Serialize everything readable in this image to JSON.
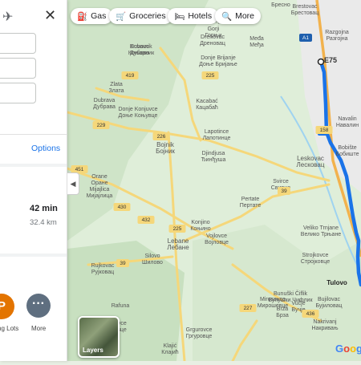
{
  "sidebar": {
    "options_label": "Options",
    "route": {
      "time": "42 min",
      "distance": "32.4 km"
    },
    "bottom_actions": [
      {
        "badge": "P",
        "label": "ng Lots"
      },
      {
        "badge": "···",
        "label": "More"
      }
    ]
  },
  "chips": [
    {
      "icon": "gas-station-icon",
      "label": "Gas"
    },
    {
      "icon": "cart-icon",
      "label": "Groceries"
    },
    {
      "icon": "bed-icon",
      "label": "Hotels"
    },
    {
      "icon": "search-icon",
      "label": "More"
    }
  ],
  "layers_label": "Layers",
  "google_logo": "Google",
  "route_color": "#1a73e8",
  "places": [
    {
      "name": "Бресно",
      "sub": ""
    },
    {
      "name": "Brestovac",
      "sub": "Брестовац"
    },
    {
      "name": "Gornji",
      "sub": ""
    },
    {
      "name": "Gorji",
      "sub": "Горњи"
    },
    {
      "name": "Drenovac",
      "sub": "Дреновац"
    },
    {
      "name": "Međa",
      "sub": "Међа"
    },
    {
      "name": "Razgojna",
      "sub": "Разгојна"
    },
    {
      "name": "Kovarnik",
      "sub": "Коњарник"
    },
    {
      "name": "Dubovo",
      "sub": "Дубово"
    },
    {
      "name": "Donje Brijanje",
      "sub": "Доње Бријање"
    },
    {
      "name": "Zlata",
      "sub": "Злата"
    },
    {
      "name": "Dubrava",
      "sub": "Дубрава"
    },
    {
      "name": "Donje Konjuvce",
      "sub": "Доње Коњувце"
    },
    {
      "name": "Kacabać",
      "sub": "Кацабаћ"
    },
    {
      "name": "Navalin",
      "sub": "Навалин"
    },
    {
      "name": "Bobište",
      "sub": "Бобиште"
    },
    {
      "name": "Lapotince",
      "sub": "Лапотинце"
    },
    {
      "name": "Bojnik",
      "sub": "Бојник"
    },
    {
      "name": "Djindjusa",
      "sub": "Ђинђуша"
    },
    {
      "name": "Leskovac",
      "sub": "Лесковац"
    },
    {
      "name": "Orane",
      "sub": "Оране"
    },
    {
      "name": "Svirce",
      "sub": "Свирце"
    },
    {
      "name": "Mijajlica",
      "sub": "Мијајлица"
    },
    {
      "name": "Pertate",
      "sub": "Пертате"
    },
    {
      "name": "Konjino",
      "sub": "Коњино"
    },
    {
      "name": "Veliko Trnjane",
      "sub": "Велико Трњане"
    },
    {
      "name": "Vojlovce",
      "sub": "Војловце"
    },
    {
      "name": "Lebane",
      "sub": "Лебане"
    },
    {
      "name": "Silovo",
      "sub": "Шилово"
    },
    {
      "name": "Strojkovce",
      "sub": "Стројковце"
    },
    {
      "name": "Rujkovac",
      "sub": "Рујковац"
    },
    {
      "name": "Tulovo",
      "sub": ""
    },
    {
      "name": "Bunuški Čiflik",
      "sub": "Бунушки Чифлик"
    },
    {
      "name": "Mirosevce",
      "sub": "Мирошевце"
    },
    {
      "name": "Vučje",
      "sub": "Вучје"
    },
    {
      "name": "Brza",
      "sub": "Брза"
    },
    {
      "name": "Bujilovac",
      "sub": "Бујиловац"
    },
    {
      "name": "Rafuna",
      "sub": ""
    },
    {
      "name": "Bovce",
      "sub": "Бувце"
    },
    {
      "name": "Nakrivanj",
      "sub": "Накривањ"
    },
    {
      "name": "Grgurovce",
      "sub": "Гргуровце"
    },
    {
      "name": "Klajić",
      "sub": "Клајић"
    }
  ],
  "road_labels": [
    "E75",
    "A1",
    "419",
    "225",
    "229",
    "226",
    "158",
    "451",
    "39",
    "430",
    "432",
    "225",
    "39",
    "227",
    "436",
    "158"
  ]
}
